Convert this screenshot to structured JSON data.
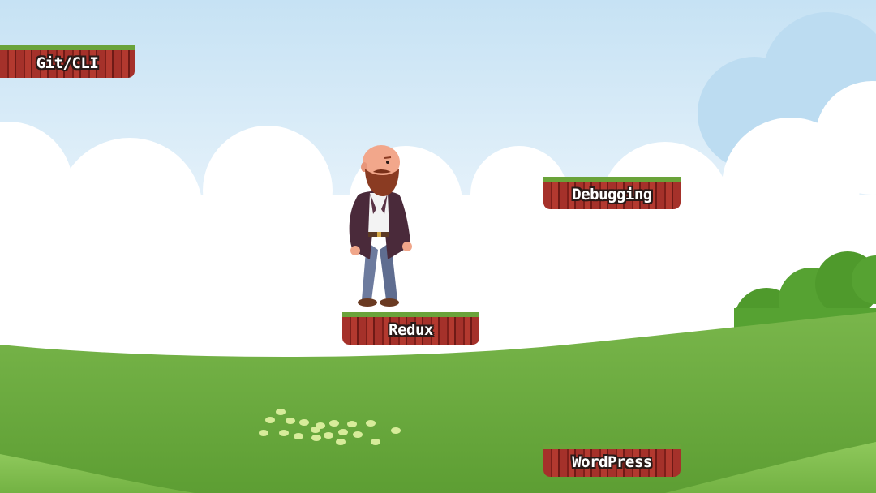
{
  "platforms": {
    "git": {
      "label": "Git/CLI"
    },
    "debugging": {
      "label": "Debugging"
    },
    "redux": {
      "label": "Redux"
    },
    "wordpress": {
      "label": "WordPress"
    }
  },
  "colors": {
    "sky": "#cfe6f5",
    "cloud": "#ffffff",
    "grass_light": "#8cc35a",
    "grass_dark": "#5ea33a",
    "platform_dirt": "#a5312a",
    "platform_grass": "#6aa33a",
    "label_text": "#ffffff",
    "label_outline": "#2a1a18"
  }
}
